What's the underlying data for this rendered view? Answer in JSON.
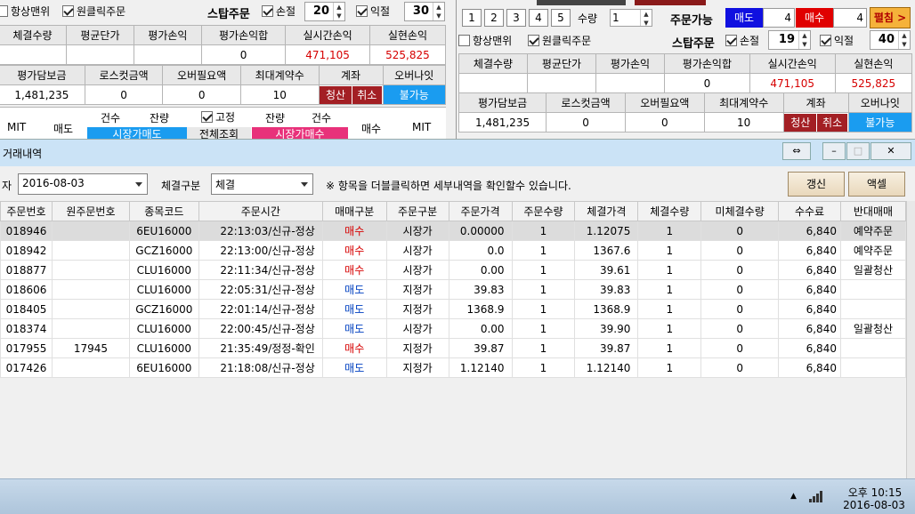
{
  "left_panel": {
    "always_top": "항상맨위",
    "one_click": "원클릭주문",
    "stop_order": "스탑주문",
    "stop_loss": "손절",
    "stop_loss_val": "20",
    "take_profit": "익절",
    "take_profit_val": "30",
    "grid1_headers": [
      "체결수량",
      "평균단가",
      "평가손익",
      "평가손익합",
      "실시간손익",
      "실현손익"
    ],
    "grid1_values": [
      "",
      "",
      "",
      "0",
      "471,105",
      "525,825"
    ],
    "grid2_headers": [
      "평가담보금",
      "로스컷금액",
      "오버필요액",
      "최대계약수",
      "계좌",
      "오버나잇"
    ],
    "grid2_values": [
      "1,481,235",
      "0",
      "0",
      "10"
    ],
    "settle": "청산",
    "cancel": "취소",
    "overnight": "불가능",
    "mit": "MIT",
    "sell": "매도",
    "count": "건수",
    "remain": "잔량",
    "fixed": "고정",
    "market_sell": "시장가매도",
    "full_query": "전체조회",
    "market_buy": "시장가매수",
    "buy": "매수"
  },
  "right_panel": {
    "tabs": [
      "1",
      "2",
      "3",
      "4",
      "5"
    ],
    "qty_label": "수량",
    "qty_val": "1",
    "order_avail": "주문가능",
    "sell": "매도",
    "sell_val": "4",
    "buy": "매수",
    "buy_val": "4",
    "fold": "펼침 >",
    "always_top": "항상맨위",
    "one_click": "원클릭주문",
    "stop_order": "스탑주문",
    "stop_loss": "손절",
    "stop_loss_val": "19",
    "take_profit": "익절",
    "take_profit_val": "40",
    "grid1_headers": [
      "체결수량",
      "평균단가",
      "평가손익",
      "평가손익합",
      "실시간손익",
      "실현손익"
    ],
    "grid1_values": [
      "",
      "",
      "",
      "0",
      "471,105",
      "525,825"
    ],
    "grid2_headers": [
      "평가담보금",
      "로스컷금액",
      "오버필요액",
      "최대계약수",
      "계좌",
      "오버나잇"
    ],
    "grid2_values": [
      "1,481,235",
      "0",
      "0",
      "10"
    ],
    "settle": "청산",
    "cancel": "취소",
    "overnight": "불가능"
  },
  "dialog": {
    "title": "거래내역",
    "date_label": "자",
    "date_val": "2016-08-03",
    "fill_label": "체결구분",
    "fill_val": "체결",
    "notice": "※ 항목을 더블클릭하면 세부내역을 확인할수 있습니다.",
    "refresh": "갱신",
    "excel": "액셀",
    "columns": [
      "주문번호",
      "원주문번호",
      "종목코드",
      "주문시간",
      "매매구분",
      "주문구분",
      "주문가격",
      "주문수량",
      "체결가격",
      "체결수량",
      "미체결수량",
      "수수료",
      "반대매매"
    ],
    "rows": [
      [
        "018946",
        "",
        "6EU16000",
        "22:13:03/신규-정상",
        "매수",
        "시장가",
        "0.00000",
        "1",
        "1.12075",
        "1",
        "0",
        "6,840",
        "예약주문"
      ],
      [
        "018942",
        "",
        "GCZ16000",
        "22:13:00/신규-정상",
        "매수",
        "시장가",
        "0.0",
        "1",
        "1367.6",
        "1",
        "0",
        "6,840",
        "예약주문"
      ],
      [
        "018877",
        "",
        "CLU16000",
        "22:11:34/신규-정상",
        "매수",
        "시장가",
        "0.00",
        "1",
        "39.61",
        "1",
        "0",
        "6,840",
        "일괄청산"
      ],
      [
        "018606",
        "",
        "CLU16000",
        "22:05:31/신규-정상",
        "매도",
        "지정가",
        "39.83",
        "1",
        "39.83",
        "1",
        "0",
        "6,840",
        ""
      ],
      [
        "018405",
        "",
        "GCZ16000",
        "22:01:14/신규-정상",
        "매도",
        "지정가",
        "1368.9",
        "1",
        "1368.9",
        "1",
        "0",
        "6,840",
        ""
      ],
      [
        "018374",
        "",
        "CLU16000",
        "22:00:45/신규-정상",
        "매도",
        "시장가",
        "0.00",
        "1",
        "39.90",
        "1",
        "0",
        "6,840",
        "일괄청산"
      ],
      [
        "017955",
        "17945",
        "CLU16000",
        "21:35:49/정정-확인",
        "매수",
        "지정가",
        "39.87",
        "1",
        "39.87",
        "1",
        "0",
        "6,840",
        ""
      ],
      [
        "017426",
        "",
        "6EU16000",
        "21:18:08/신규-정상",
        "매도",
        "지정가",
        "1.12140",
        "1",
        "1.12140",
        "1",
        "0",
        "6,840",
        ""
      ]
    ]
  },
  "taskbar": {
    "time": "오후 10:15",
    "date": "2016-08-03"
  },
  "colors": {
    "sell": "#0040c0",
    "buy": "#d60000"
  }
}
